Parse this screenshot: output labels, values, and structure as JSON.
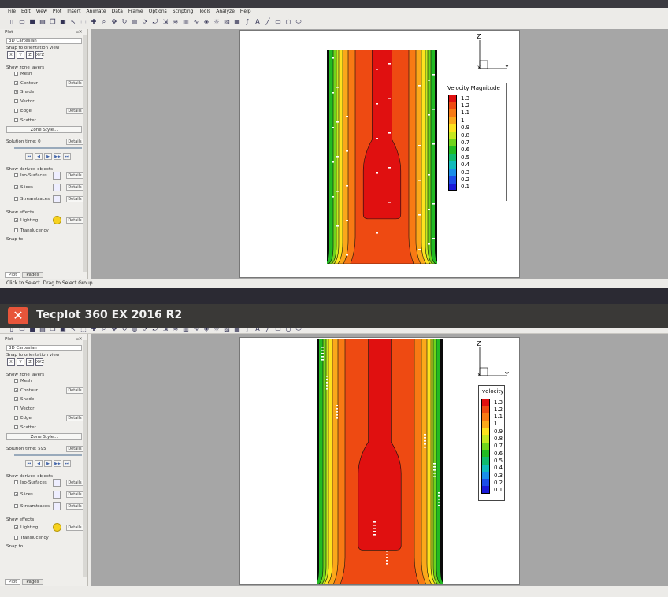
{
  "app": {
    "title": "Tecplot 360 EX 2016 R2"
  },
  "menu": [
    "File",
    "Edit",
    "View",
    "Plot",
    "Insert",
    "Animate",
    "Data",
    "Frame",
    "Options",
    "Scripting",
    "Tools",
    "Analyze",
    "Help"
  ],
  "toolbar": {
    "icons": [
      "new-icon",
      "open-icon",
      "save-icon",
      "print-icon",
      "copy-icon",
      "paste-icon",
      "pointer-icon",
      "select-icon",
      "probe-icon",
      "zoom-icon",
      "translate-icon",
      "rotate-icon",
      "rollerball-icon",
      "spin-icon",
      "twist-icon",
      "push-icon",
      "contour-tool-icon",
      "slice-icon",
      "streamtrace-icon",
      "iso-icon",
      "lighting-icon",
      "image-icon",
      "data-icon",
      "fx-icon",
      "text-icon",
      "line-icon",
      "rect-icon",
      "circle-icon",
      "ellipse-icon"
    ]
  },
  "sidebar": {
    "header": "Plot",
    "plot_type": "3D Cartesian",
    "snap_label": "Snap to orientation view",
    "orient": [
      "X",
      "Y",
      "Z",
      "XYZ"
    ],
    "zone_layers_label": "Show zone layers",
    "layers": [
      {
        "label": "Mesh",
        "checked": false,
        "details": false
      },
      {
        "label": "Contour",
        "checked": true,
        "details": true
      },
      {
        "label": "Shade",
        "checked": true,
        "details": false
      },
      {
        "label": "Vector",
        "checked": false,
        "details": false
      },
      {
        "label": "Edge",
        "checked": false,
        "details": true
      },
      {
        "label": "Scatter",
        "checked": false,
        "details": false
      }
    ],
    "details_label": "Details",
    "zone_style": "Zone Style...",
    "derived_label": "Show derived objects",
    "derived": [
      {
        "label": "Iso-Surfaces",
        "checked": false
      },
      {
        "label": "Slices",
        "checked": true
      },
      {
        "label": "Streamtraces",
        "checked": false
      }
    ],
    "effects_label": "Show effects",
    "effects": [
      {
        "label": "Lighting",
        "checked": true
      },
      {
        "label": "Translucency",
        "checked": false
      }
    ],
    "snap_to": "Snap to",
    "tabs": [
      "Plot",
      "Pages"
    ]
  },
  "win1": {
    "solution_time": "Solution time: 0",
    "status": "Click to Select. Drag to Select Group",
    "legend_title": "Velocity Magnitude",
    "legend_levels": [
      "1.3",
      "1.2",
      "1.1",
      "1",
      "0.9",
      "0.8",
      "0.7",
      "0.6",
      "0.5",
      "0.4",
      "0.3",
      "0.2",
      "0.1"
    ]
  },
  "win2": {
    "solution_time": "Solution time: 595",
    "legend_title": "velocity",
    "legend_levels": [
      "1.3",
      "1.2",
      "1.1",
      "1",
      "0.9",
      "0.8",
      "0.7",
      "0.6",
      "0.5",
      "0.4",
      "0.3",
      "0.2",
      "0.1"
    ]
  },
  "axes": {
    "z": "Z",
    "y": "Y",
    "x": "X"
  },
  "colors": [
    "#e01010",
    "#ee4a12",
    "#f87a14",
    "#fba81a",
    "#fde21e",
    "#c5e820",
    "#70d41c",
    "#22bb22",
    "#11bb6e",
    "#11bbbb",
    "#1a8ee8",
    "#1c4ee8",
    "#1a1ad8"
  ]
}
